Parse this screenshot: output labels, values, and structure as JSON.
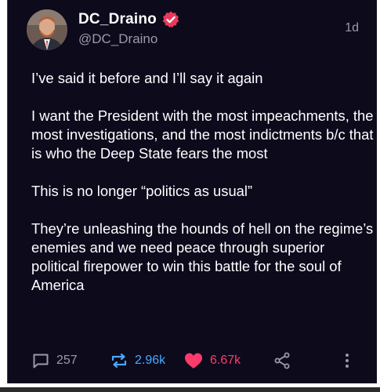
{
  "post": {
    "display_name": "DC_Draino",
    "handle": "@DC_Draino",
    "time": "1d",
    "paragraphs": [
      "I’ve said it before and I’ll say it again",
      "I want the President with the most impeachments, the most investigations, and the most indictments b/c that is who the Deep State fears the most",
      "This is no longer “politics as usual”",
      "They’re unleashing the hounds of hell on the regime’s enemies and we need peace through superior political firepower to win this battle for the soul of America"
    ]
  },
  "actions": {
    "replies": "257",
    "reposts": "2.96k",
    "likes": "6.67k",
    "icons": [
      "reply-icon",
      "repost-icon",
      "heart-icon",
      "share-icon",
      "more-icon"
    ]
  },
  "colors": {
    "background": "#0d0a1c",
    "text": "#ffffff",
    "muted": "#9a9aa8",
    "repost": "#4aa8ff",
    "like": "#ff3b6b",
    "verified": "#e8395b"
  }
}
